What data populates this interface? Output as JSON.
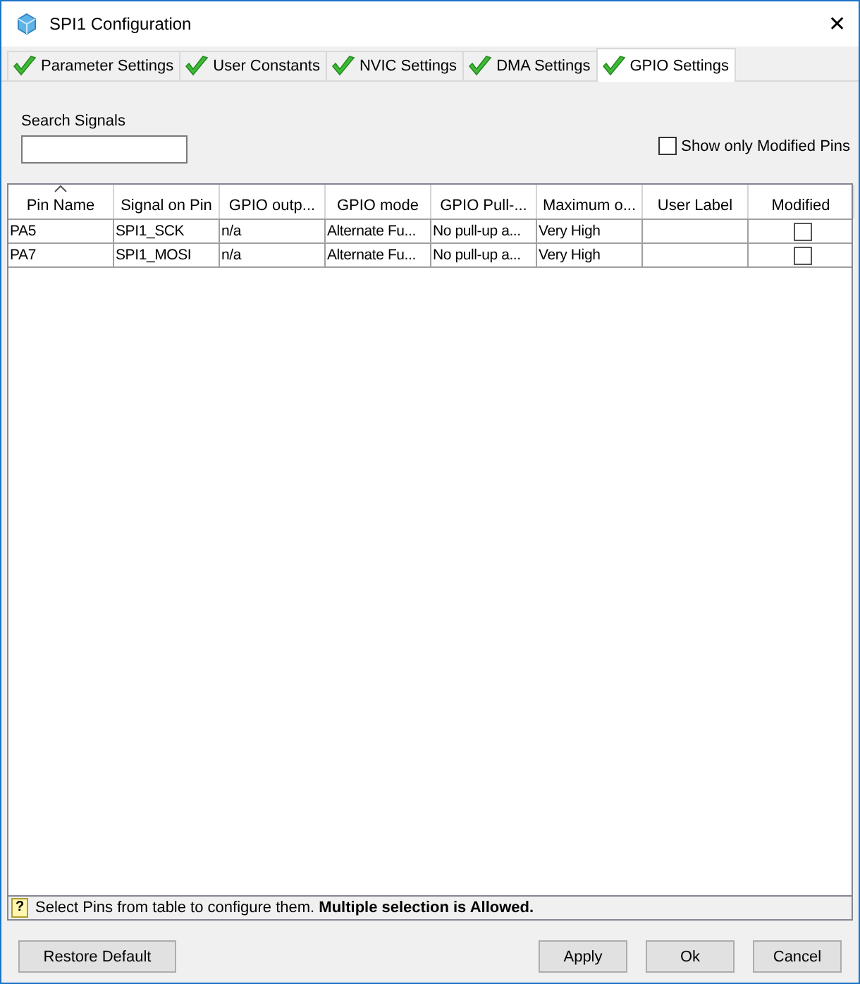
{
  "window": {
    "title": "SPI1 Configuration",
    "close_glyph": "✕"
  },
  "tabs": [
    {
      "label": "Parameter Settings",
      "selected": false
    },
    {
      "label": "User Constants",
      "selected": false
    },
    {
      "label": "NVIC Settings",
      "selected": false
    },
    {
      "label": "DMA Settings",
      "selected": false
    },
    {
      "label": "GPIO Settings",
      "selected": true
    }
  ],
  "search": {
    "label": "Search Signals"
  },
  "filter": {
    "label": "Show only Modified Pins",
    "checked": false
  },
  "table": {
    "columns": [
      {
        "label": "Pin Name",
        "sorted": true
      },
      {
        "label": "Signal on Pin",
        "sorted": false
      },
      {
        "label": "GPIO outp...",
        "sorted": false
      },
      {
        "label": "GPIO mode",
        "sorted": false
      },
      {
        "label": "GPIO Pull-...",
        "sorted": false
      },
      {
        "label": "Maximum o...",
        "sorted": false
      },
      {
        "label": "User Label",
        "sorted": false
      },
      {
        "label": "Modified",
        "sorted": false
      }
    ],
    "rows": [
      {
        "cells": [
          "PA5",
          "SPI1_SCK",
          "n/a",
          "Alternate Fu...",
          "No pull-up a...",
          "Very High",
          ""
        ],
        "modified": false
      },
      {
        "cells": [
          "PA7",
          "SPI1_MOSI",
          "n/a",
          "Alternate Fu...",
          "No pull-up a...",
          "Very High",
          ""
        ],
        "modified": false
      }
    ]
  },
  "status_bar": {
    "glyph": "?",
    "text": "Select Pins from table to configure them. **Multiple selection is Allowed.**"
  },
  "buttons": {
    "left": [
      "Restore Default"
    ],
    "right": [
      "Apply",
      "Ok",
      "Cancel"
    ]
  }
}
